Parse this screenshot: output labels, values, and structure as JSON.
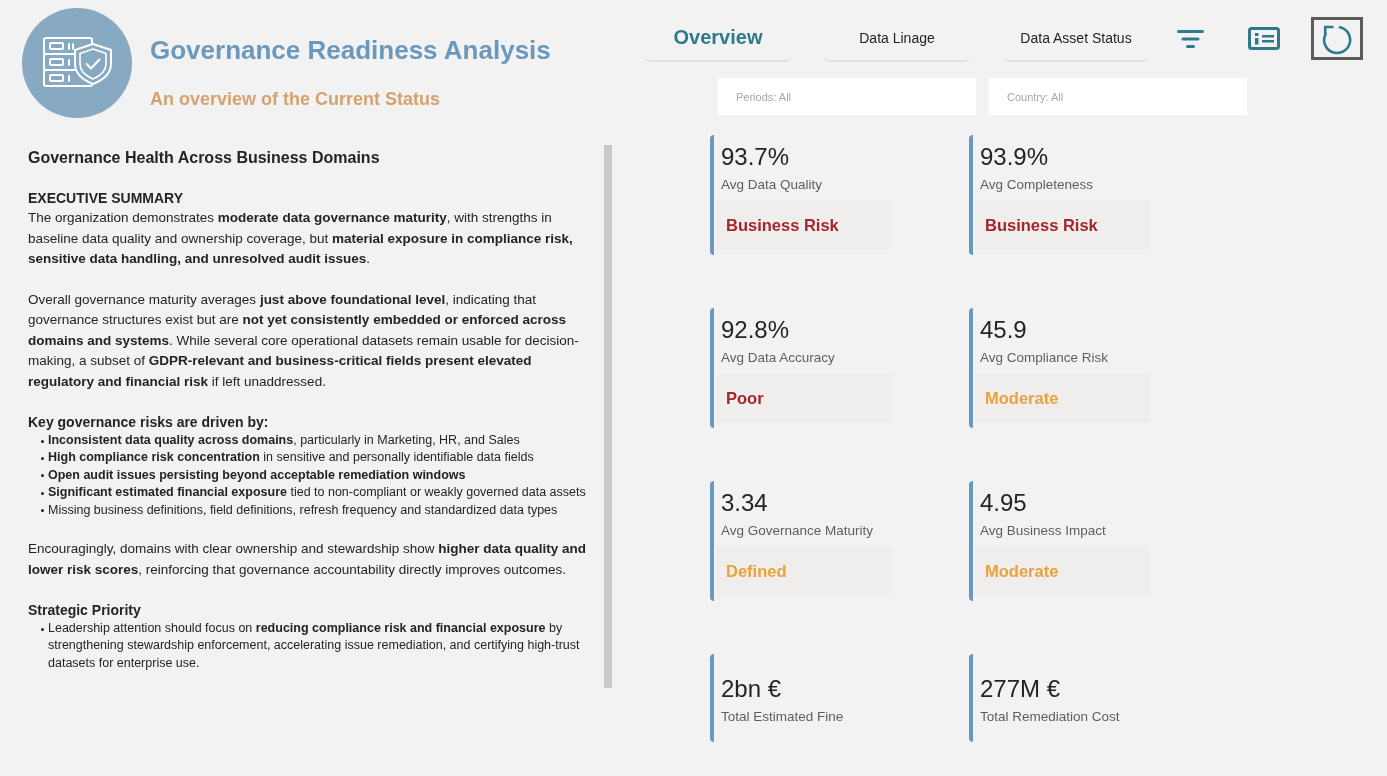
{
  "header": {
    "title": "Governance Readiness Analysis",
    "subtitle": "An overview of the Current Status"
  },
  "tabs": [
    {
      "label": "Overview",
      "selected": true
    },
    {
      "label": "Data Linage",
      "selected": false
    },
    {
      "label": "Data Asset Status",
      "selected": false
    }
  ],
  "filters": [
    {
      "placeholder": "Periods: All"
    },
    {
      "placeholder": "Country: All"
    }
  ],
  "summary": {
    "title": "Governance Health Across Business Domains",
    "blocks": [
      {
        "kind": "heading",
        "text": "EXECUTIVE SUMMARY"
      },
      {
        "kind": "paragraph",
        "text": "The organization demonstrates **moderate data governance maturity**, with strengths in baseline data quality and ownership coverage, but **material exposure in compliance risk, sensitive data handling, and unresolved audit issues**."
      },
      {
        "kind": "paragraph",
        "text": "Overall governance maturity averages **just above foundational level**, indicating that governance structures exist but are **not yet consistently embedded or enforced across domains and systems**. While several core operational datasets remain usable for decision-making, a subset of **GDPR-relevant and business-critical fields present elevated regulatory and financial risk** if left unaddressed."
      },
      {
        "kind": "heading",
        "text": "Key governance risks are driven by:"
      },
      {
        "kind": "bullets",
        "items": [
          "**Inconsistent data quality across domains**, particularly in Marketing, HR, and Sales",
          "**High compliance risk concentration** in sensitive and personally identifiable data fields",
          "**Open audit issues persisting beyond acceptable remediation windows**",
          "**Significant estimated financial exposure** tied to non-compliant or weakly governed data assets",
          "Missing business definitions, field definitions, refresh frequency and standardized data types"
        ]
      },
      {
        "kind": "paragraph",
        "text": "Encouragingly, domains with clear ownership and stewardship show **higher data quality and lower risk scores**, reinforcing that governance accountability directly improves outcomes."
      },
      {
        "kind": "heading",
        "text": "Strategic Priority"
      },
      {
        "kind": "bullets",
        "items": [
          "Leadership attention should focus on **reducing compliance risk and financial exposure** by strengthening stewardship enforcement, accelerating issue remediation, and certifying high-trust datasets for enterprise use."
        ]
      }
    ]
  },
  "kpis": [
    {
      "value": "93.7%",
      "label": "Avg Data Quality",
      "status": "Business Risk",
      "color": "#a4262c"
    },
    {
      "value": "93.9%",
      "label": "Avg Completeness",
      "status": "Business Risk",
      "color": "#a4262c"
    },
    {
      "value": "92.8%",
      "label": "Avg Data Accuracy",
      "status": "Poor",
      "color": "#a4262c"
    },
    {
      "value": "45.9",
      "label": "Avg Compliance Risk",
      "status": "Moderate",
      "color": "#e9a23b"
    },
    {
      "value": "3.34",
      "label": "Avg Governance Maturity",
      "status": "Defined",
      "color": "#e9a23b"
    },
    {
      "value": "4.95",
      "label": "Avg Business Impact",
      "status": "Moderate",
      "color": "#e9a23b"
    },
    {
      "value": "2bn €",
      "label": "Total Estimated Fine"
    },
    {
      "value": "277M €",
      "label": "Total Remediation Cost"
    }
  ]
}
